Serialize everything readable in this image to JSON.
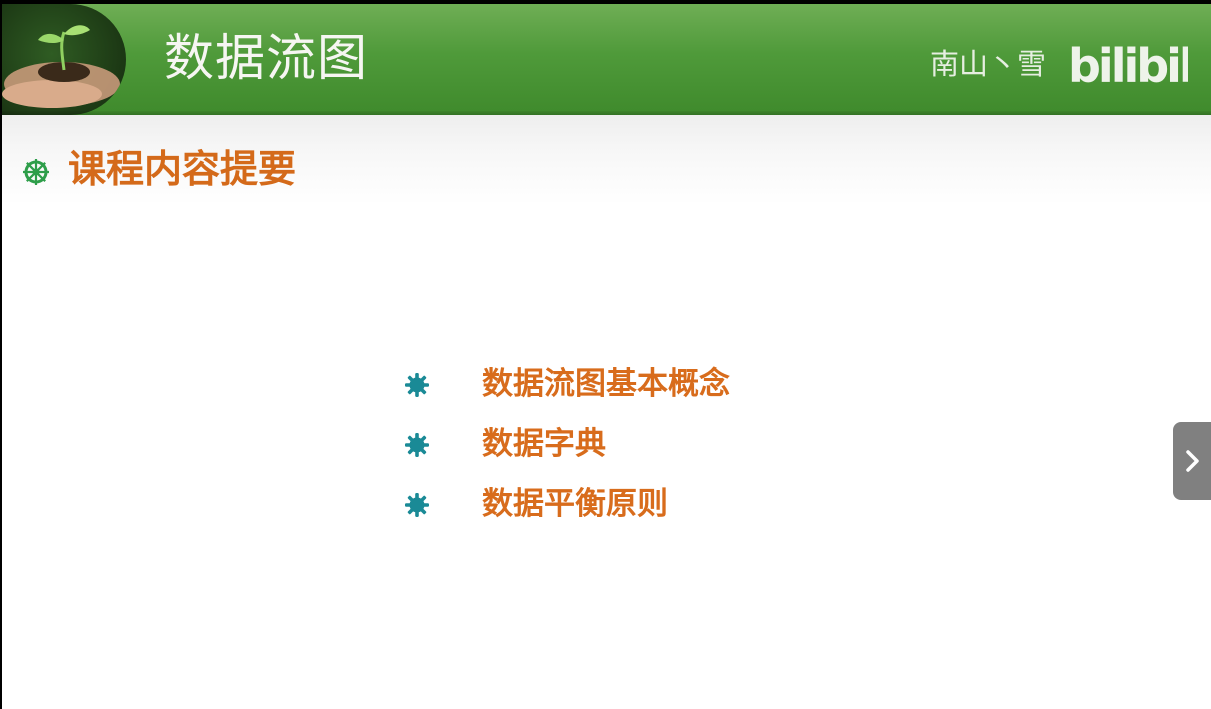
{
  "header": {
    "title": "数据流图",
    "watermark_author": "南山丶雪",
    "watermark_brand": "bilibili",
    "photo_icon": "seedling-in-hands-icon"
  },
  "section": {
    "heading": "课程内容提要",
    "bullet_icon": "wheel-bullet-icon",
    "bullet_color": "#2e9e4a"
  },
  "list": {
    "bullet_icon": "gear-bullet-icon",
    "bullet_color": "#1a8a96",
    "items": [
      {
        "label": "数据流图基本概念"
      },
      {
        "label": "数据字典"
      },
      {
        "label": "数据平衡原则"
      }
    ]
  },
  "navigation": {
    "next_icon": "chevron-right-icon"
  },
  "colors": {
    "header_green": "#4f9a3a",
    "accent_orange": "#d86c1c",
    "nav_gray": "#808080"
  }
}
